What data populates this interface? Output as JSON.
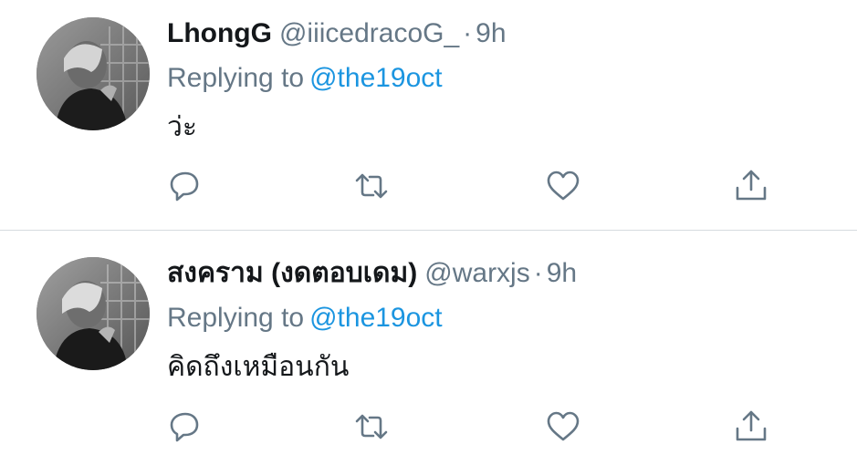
{
  "colors": {
    "text_primary": "#14171a",
    "text_secondary": "#657786",
    "link": "#1b95e0",
    "divider": "#d6dbdf",
    "icon": "#657786"
  },
  "tweets": [
    {
      "display_name": "LhongG",
      "handle": "@iiicedracoG_",
      "separator": "·",
      "time": "9h",
      "replying_prefix": "Replying to",
      "replying_to": "@the19oct",
      "text": "ว่ะ",
      "actions": [
        "reply-icon",
        "retweet-icon",
        "like-icon",
        "share-icon"
      ]
    },
    {
      "display_name": "สงคราม (งดตอบเดม)",
      "handle": "@warxjs",
      "separator": "·",
      "time": "9h",
      "replying_prefix": "Replying to",
      "replying_to": "@the19oct",
      "text": "คิดถึงเหมือนกัน",
      "actions": [
        "reply-icon",
        "retweet-icon",
        "like-icon",
        "share-icon"
      ]
    }
  ]
}
